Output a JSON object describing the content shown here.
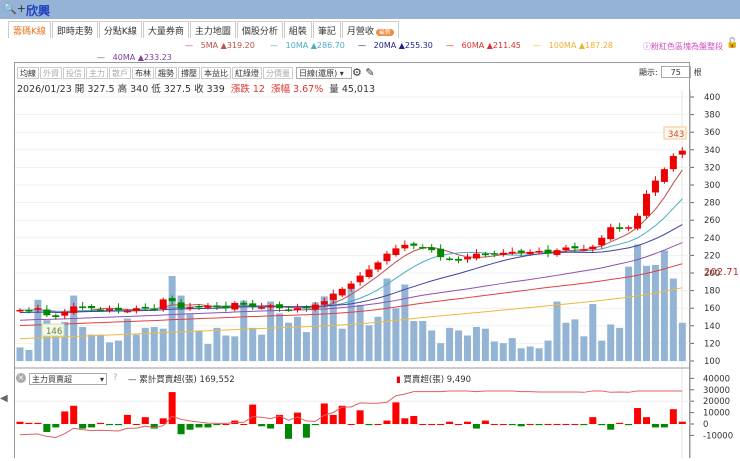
{
  "window": {
    "title": "欣興",
    "search_icon": "magnifier-plus"
  },
  "tabs": [
    {
      "label": "籌碼K線",
      "active": true
    },
    {
      "label": "即時走勢"
    },
    {
      "label": "分點K線"
    },
    {
      "label": "大量券商"
    },
    {
      "label": "主力地圖"
    },
    {
      "label": "個股分析"
    },
    {
      "label": "組裝"
    },
    {
      "label": "筆記"
    },
    {
      "label": "月營收",
      "badge": "最新"
    }
  ],
  "ma_legend": [
    {
      "name": "5MA",
      "value": "319.20",
      "color": "#c0504d"
    },
    {
      "name": "10MA",
      "value": "286.70",
      "color": "#4bacc6"
    },
    {
      "name": "20MA",
      "value": "255.30",
      "color": "#1f1f8f"
    },
    {
      "name": "60MA",
      "value": "211.45",
      "color": "#e03030"
    },
    {
      "name": "100MA",
      "value": "187.28",
      "color": "#f0b030"
    },
    {
      "name": "40MA",
      "value": "233.23",
      "color": "#8040a0"
    }
  ],
  "hint": "ⓘ粉紅色區塊為盤整段",
  "toolbar": {
    "buttons": [
      {
        "label": "均線"
      },
      {
        "label": "外資",
        "disabled": true
      },
      {
        "label": "投信",
        "disabled": true
      },
      {
        "label": "主力",
        "disabled": true
      },
      {
        "label": "散戶",
        "disabled": true
      },
      {
        "label": "布林"
      },
      {
        "label": "趨勢"
      },
      {
        "label": "撐壓"
      },
      {
        "label": "本益比"
      },
      {
        "label": "紅綠燈"
      },
      {
        "label": "分價量",
        "disabled": true
      }
    ],
    "period": "日線(還原)",
    "display_label": "顯示:",
    "display_count": "75",
    "display_unit": "根"
  },
  "info": {
    "date": "2026/01/23",
    "open_label": "開",
    "open": "327.5",
    "high_label": "高",
    "high": "340",
    "low_label": "低",
    "low": "327.5",
    "close_label": "收",
    "close": "339",
    "change_label": "漲跌",
    "change": "12",
    "pct_label": "漲幅",
    "pct": "3.67%",
    "vol_label": "量",
    "vol": "45,013"
  },
  "price_axis": {
    "ticks": [
      "400",
      "380",
      "360",
      "340",
      "320",
      "300",
      "280",
      "260",
      "240",
      "220",
      "200",
      "180",
      "160",
      "140",
      "120",
      "100"
    ],
    "current_marker": "202.71",
    "high_marker": "343",
    "low_marker": "146"
  },
  "chart_data": {
    "type": "candlestick",
    "ylim": [
      100,
      400
    ],
    "close": [
      158,
      157,
      160,
      152,
      150,
      156,
      162,
      161,
      160,
      158,
      159,
      158,
      157,
      160,
      161,
      159,
      170,
      168,
      160,
      161,
      162,
      163,
      161,
      160,
      166,
      164,
      162,
      161,
      163,
      160,
      158,
      160,
      160,
      164,
      168,
      176,
      182,
      188,
      197,
      204,
      212,
      222,
      228,
      232,
      231,
      229,
      226,
      218,
      216,
      214,
      218,
      222,
      221,
      222,
      223,
      224,
      223,
      224,
      225,
      222,
      226,
      229,
      228,
      227,
      230,
      240,
      252,
      250,
      252,
      265,
      290,
      305,
      318,
      333,
      339
    ],
    "volume": [
      16,
      13,
      72,
      48,
      37,
      46,
      77,
      40,
      31,
      31,
      22,
      24,
      50,
      31,
      39,
      40,
      38,
      100,
      77,
      55,
      36,
      20,
      39,
      30,
      29,
      71,
      39,
      31,
      70,
      56,
      45,
      52,
      34,
      69,
      76,
      80,
      38,
      87,
      66,
      42,
      52,
      97,
      62,
      90,
      47,
      47,
      36,
      21,
      39,
      36,
      30,
      40,
      38,
      23,
      21,
      27,
      15,
      17,
      15,
      24,
      70,
      45,
      49,
      29,
      67,
      24,
      43,
      39,
      111,
      137,
      112,
      113,
      130,
      97,
      45
    ],
    "bar_gradient_markers": true
  },
  "sub_panel": {
    "indicator": "主力買賣超",
    "help": "?",
    "cum_label": "累計買賣超(張)",
    "cum_value": "169,552",
    "net_label": "買賣超(張)",
    "net_value": "9,490",
    "axis": [
      "40000",
      "30000",
      "20000",
      "10000",
      "0",
      "-10000"
    ],
    "net": [
      2,
      1,
      1,
      -7,
      -3,
      11,
      16,
      -4,
      -3,
      1,
      -1,
      -1,
      8,
      0,
      6,
      -4,
      5,
      28,
      -9,
      -5,
      -3,
      -3,
      -1,
      0,
      3,
      0,
      17,
      -2,
      -4,
      8,
      -13,
      10,
      -12,
      -1,
      18,
      8,
      16,
      0,
      12,
      -1,
      0,
      3,
      19,
      5,
      7,
      0,
      0,
      0,
      2,
      0,
      2,
      -4,
      3,
      0,
      0,
      -1,
      -2,
      0,
      -1,
      0,
      0,
      0,
      0,
      -1,
      6,
      -1,
      -5,
      1,
      -1,
      14,
      6,
      -3,
      -3,
      13,
      2,
      -2,
      6,
      -1,
      9
    ]
  }
}
